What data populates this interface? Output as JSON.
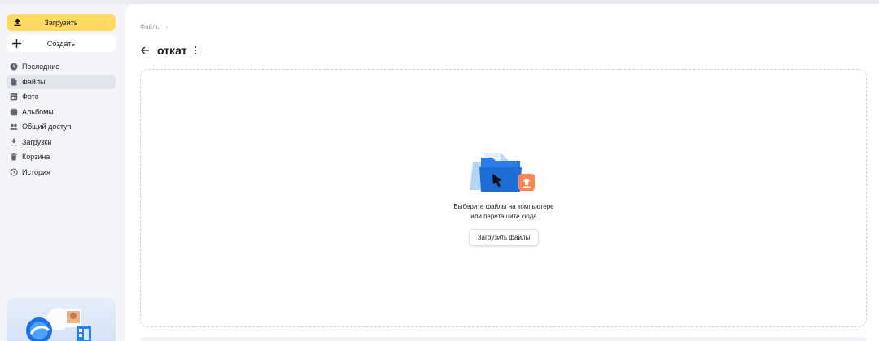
{
  "sidebar": {
    "upload_label": "Загрузить",
    "create_label": "Создать",
    "items": [
      {
        "label": "Последние",
        "icon": "clock-icon"
      },
      {
        "label": "Файлы",
        "icon": "file-icon"
      },
      {
        "label": "Фото",
        "icon": "photo-icon"
      },
      {
        "label": "Альбомы",
        "icon": "albums-icon"
      },
      {
        "label": "Общий доступ",
        "icon": "shared-icon"
      },
      {
        "label": "Загрузки",
        "icon": "download-icon"
      },
      {
        "label": "Корзина",
        "icon": "trash-icon"
      },
      {
        "label": "История",
        "icon": "history-icon"
      }
    ],
    "active_item": "Файлы",
    "promo_close": "×"
  },
  "main": {
    "breadcrumb": "Файлы",
    "breadcrumb_sep": "›",
    "title": "откат",
    "drop_text_line1": "Выберите файлы на компьютере",
    "drop_text_line2": "или перетащите сюда",
    "upload_files_label": "Загрузить файлы"
  },
  "colors": {
    "accent_yellow": "#ffd964",
    "sidebar_bg": "#f4f5f9",
    "folder_blue": "#2b7de9",
    "upload_orange": "#ff7a45"
  }
}
